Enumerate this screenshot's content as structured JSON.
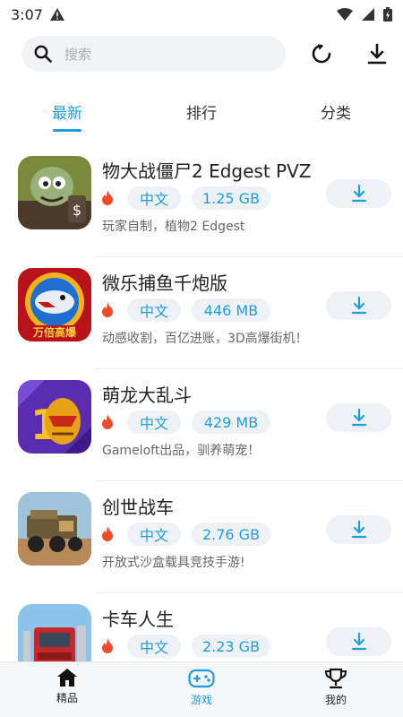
{
  "status_bar": {
    "time": "3:07"
  },
  "search": {
    "placeholder": "搜索"
  },
  "tabs": [
    {
      "label": "最新",
      "active": true
    },
    {
      "label": "排行",
      "active": false
    },
    {
      "label": "分类",
      "active": false
    }
  ],
  "games": [
    {
      "name": "物大战僵尸2 Edgest PVZ",
      "language": "中文",
      "size": "1.25 GB",
      "description": "玩家自制，植物2 Edgest",
      "icon": "zombie-game-icon"
    },
    {
      "name": "微乐捕鱼千炮版",
      "language": "中文",
      "size": "446 MB",
      "description": "动感收割，百亿进账，3D高爆街机！",
      "icon": "fishing-game-icon",
      "icon_caption": "万倍高爆"
    },
    {
      "name": "萌龙大乱斗",
      "language": "中文",
      "size": "429 MB",
      "description": "Gameloft出品，驯养萌宠！",
      "icon": "dragon-game-icon"
    },
    {
      "name": "创世战车",
      "language": "中文",
      "size": "2.76 GB",
      "description": "开放式沙盒载具竞技手游!",
      "icon": "truck-battle-game-icon"
    },
    {
      "name": "卡车人生",
      "language": "中文",
      "size": "2.23 GB",
      "description": "",
      "icon": "truck-life-game-icon"
    }
  ],
  "bottom_nav": [
    {
      "label": "精品",
      "icon": "home-icon",
      "active": false
    },
    {
      "label": "游戏",
      "icon": "gamepad-icon",
      "active": true
    },
    {
      "label": "我的",
      "icon": "trophy-icon",
      "active": false
    }
  ],
  "colors": {
    "accent": "#1e9de0",
    "fire": "#f04a2a",
    "tag_bg": "#eef2f7",
    "nav_bg": "#f6f7f9"
  }
}
